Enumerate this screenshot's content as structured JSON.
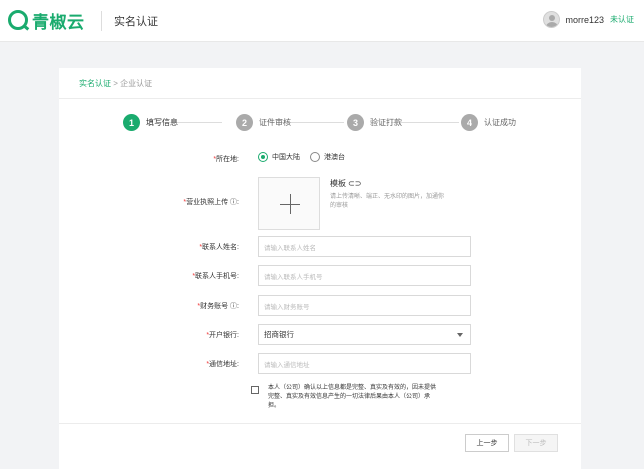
{
  "header": {
    "logo_text": "青椒云",
    "title": "实名认证",
    "username": "morre123",
    "verify_status": "未认证"
  },
  "breadcrumb": {
    "parent": "实名认证",
    "separator": ">",
    "current": "企业认证"
  },
  "steps": [
    {
      "number": "1",
      "label": "填写信息",
      "active": true
    },
    {
      "number": "2",
      "label": "证件审核",
      "active": false
    },
    {
      "number": "3",
      "label": "验证打款",
      "active": false
    },
    {
      "number": "4",
      "label": "认证成功",
      "active": false
    }
  ],
  "form": {
    "location": {
      "label": "所在地:",
      "options": [
        {
          "label": "中国大陆",
          "checked": true
        },
        {
          "label": "港澳台",
          "checked": false
        }
      ]
    },
    "license": {
      "label": "营业执照上传",
      "help_icon": "question-circle-icon",
      "template_link": "模板",
      "link_icon": "link-icon",
      "tip": "请上传清晰、端正、无水印的图片，加通你的审核"
    },
    "contact_name": {
      "label": "联系人姓名:",
      "placeholder": "请输入联系人姓名"
    },
    "contact_phone": {
      "label": "联系人手机号:",
      "placeholder": "请输入联系人手机号"
    },
    "finance_account": {
      "label": "财务账号",
      "placeholder": "请输入财务账号"
    },
    "bank": {
      "label": "开户银行:",
      "value": "招商银行"
    },
    "address": {
      "label": "通信地址:",
      "placeholder": "请输入通信地址"
    },
    "agreement": "本人（公司）确认以上信息都是完整、真实及有效的，因未提供完整、真实及有效信息产生的一切法律后果由本人（公司）承担。"
  },
  "buttons": {
    "prev": "上一步",
    "next": "下一步"
  },
  "colors": {
    "brand": "#1aab6e",
    "required": "#e33333"
  }
}
